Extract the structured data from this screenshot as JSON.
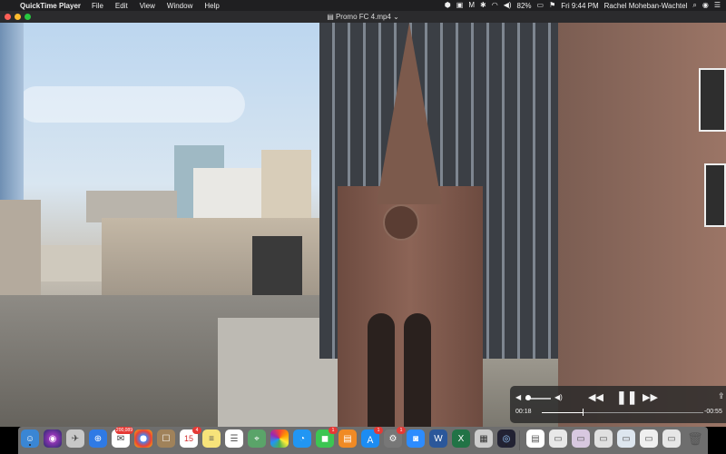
{
  "menubar": {
    "app_name": "QuickTime Player",
    "menus": [
      "File",
      "Edit",
      "View",
      "Window",
      "Help"
    ],
    "battery": "82%",
    "clock": "Fri 9:44 PM",
    "user": "Rachel Moheban-Wachtel"
  },
  "window": {
    "title": "Promo FC 4.mp4"
  },
  "player": {
    "elapsed": "00:18",
    "remaining": "-00:55",
    "progress": 0.25,
    "volume": 0.1
  },
  "dock": {
    "badges": {
      "calendar_date": "15",
      "mail": "200,089",
      "calendar": "4",
      "messages": "1",
      "appstore": "1",
      "preferences": "1"
    }
  }
}
